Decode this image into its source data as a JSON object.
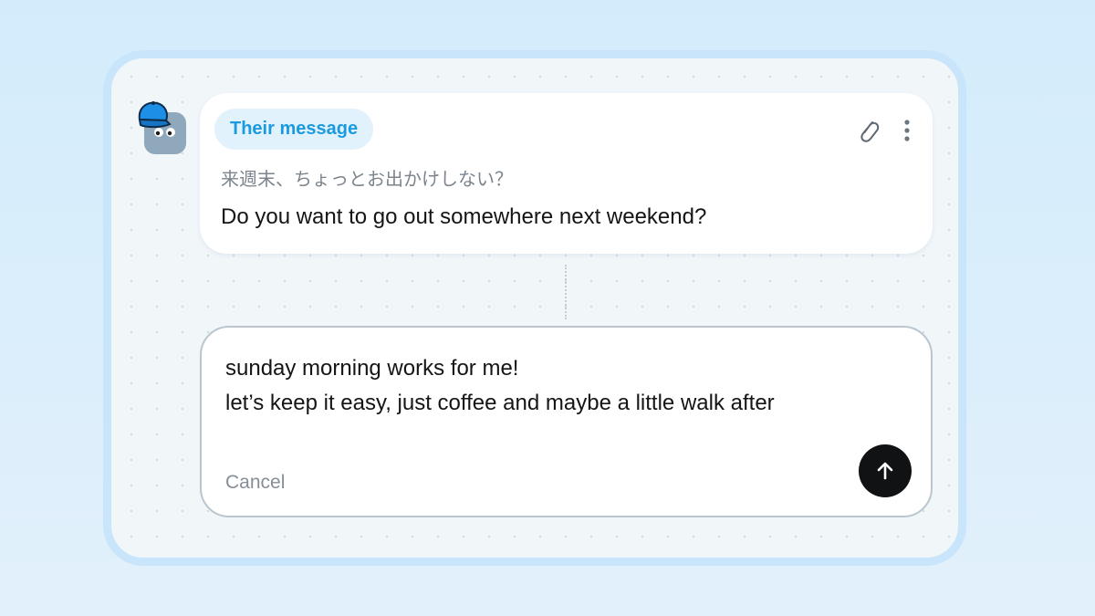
{
  "message": {
    "tag_label": "Their message",
    "original_text": "来週末、ちょっとお出かけしない？",
    "translated_text": "Do you want to go out somewhere next weekend?"
  },
  "reply": {
    "text": "sunday morning works for me!\nlet’s keep it easy, just coffee and maybe a little walk after",
    "cancel_label": "Cancel"
  },
  "icons": {
    "avatar": "avatar-with-blue-cap",
    "attach": "paperclip-icon",
    "more": "more-vertical-icon",
    "send": "arrow-up-icon"
  },
  "colors": {
    "accent": "#1b9ae0",
    "tag_background": "#e2f2fc",
    "send_button": "#101214",
    "frame_border": "#c9e5fb"
  }
}
